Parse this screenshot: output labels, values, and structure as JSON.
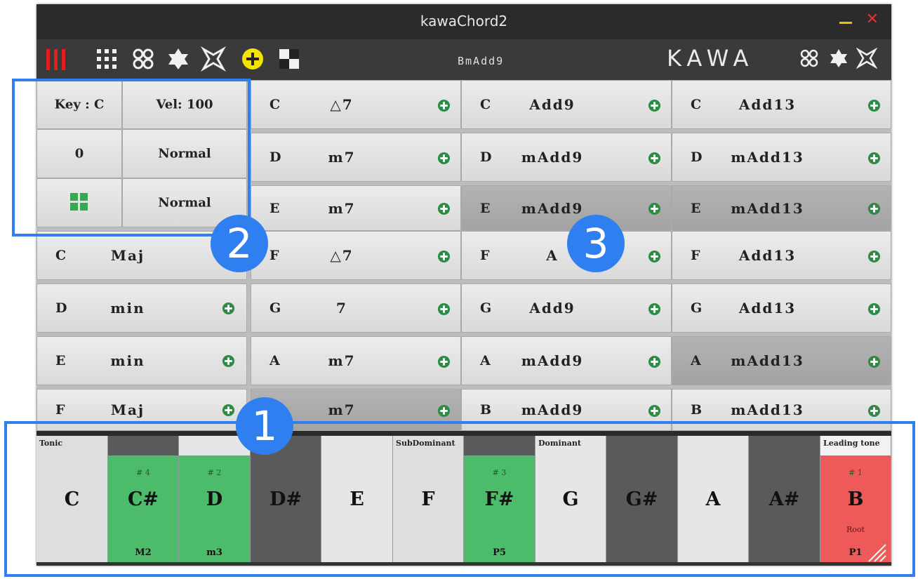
{
  "window": {
    "title": "kawaChord2"
  },
  "toolbar": {
    "chord_name": "BmAdd9",
    "brand": "KAWA"
  },
  "settings": {
    "key": "Key : C",
    "velocity": "Vel: 100",
    "octave": "0",
    "mode1": "Normal",
    "mode2": "Normal"
  },
  "diatonic": [
    {
      "root": "C",
      "type": "Maj"
    },
    {
      "root": "D",
      "type": "min"
    },
    {
      "root": "E",
      "type": "min"
    },
    {
      "root": "F",
      "type": "Maj"
    }
  ],
  "col2": [
    {
      "root": "C",
      "type": "△7"
    },
    {
      "root": "D",
      "type": "m7"
    },
    {
      "root": "E",
      "type": "m7"
    },
    {
      "root": "F",
      "type": "△7"
    },
    {
      "root": "G",
      "type": "7"
    },
    {
      "root": "A",
      "type": "m7"
    },
    {
      "root": "",
      "type": "m7"
    }
  ],
  "col3": [
    {
      "root": "C",
      "type": "Add9"
    },
    {
      "root": "D",
      "type": "mAdd9"
    },
    {
      "root": "E",
      "type": "mAdd9"
    },
    {
      "root": "F",
      "type": "A"
    },
    {
      "root": "G",
      "type": "Add9"
    },
    {
      "root": "A",
      "type": "mAdd9"
    },
    {
      "root": "B",
      "type": "mAdd9"
    }
  ],
  "col4": [
    {
      "root": "C",
      "type": "Add13"
    },
    {
      "root": "D",
      "type": "mAdd13"
    },
    {
      "root": "E",
      "type": "mAdd13"
    },
    {
      "root": "F",
      "type": "Add13"
    },
    {
      "root": "G",
      "type": "Add13"
    },
    {
      "root": "A",
      "type": "mAdd13"
    },
    {
      "root": "B",
      "type": "mAdd13"
    }
  ],
  "keys": [
    {
      "note": "C",
      "label": "Tonic",
      "color": "#dedede"
    },
    {
      "note": "C#",
      "degree": "# 4",
      "interval": "M2",
      "color": "#4cbb6a"
    },
    {
      "note": "D",
      "degree": "# 2",
      "interval": "m3",
      "color": "#4cbb6a"
    },
    {
      "note": "D#",
      "color": "#5a5a5a"
    },
    {
      "note": "E",
      "color": "#e6e6e6"
    },
    {
      "note": "F",
      "label": "SubDominant",
      "color": "#dedede"
    },
    {
      "note": "F#",
      "degree": "# 3",
      "interval": "P5",
      "color": "#4cbb6a"
    },
    {
      "note": "G",
      "label": "Dominant",
      "color": "#e6e6e6"
    },
    {
      "note": "G#",
      "color": "#5a5a5a"
    },
    {
      "note": "A",
      "color": "#e6e6e6"
    },
    {
      "note": "A#",
      "color": "#5a5a5a"
    },
    {
      "note": "B",
      "label": "Leading tone",
      "degree": "# 1",
      "root_label": "Root",
      "interval": "P1",
      "color": "#ee5a5a"
    }
  ],
  "annotations": {
    "badge1": "1",
    "badge2": "2",
    "badge3": "3"
  },
  "colors": {
    "accent_blue": "#2f7ff0",
    "plus_green": "#2e8b45",
    "active_red": "#ee5a5a"
  }
}
